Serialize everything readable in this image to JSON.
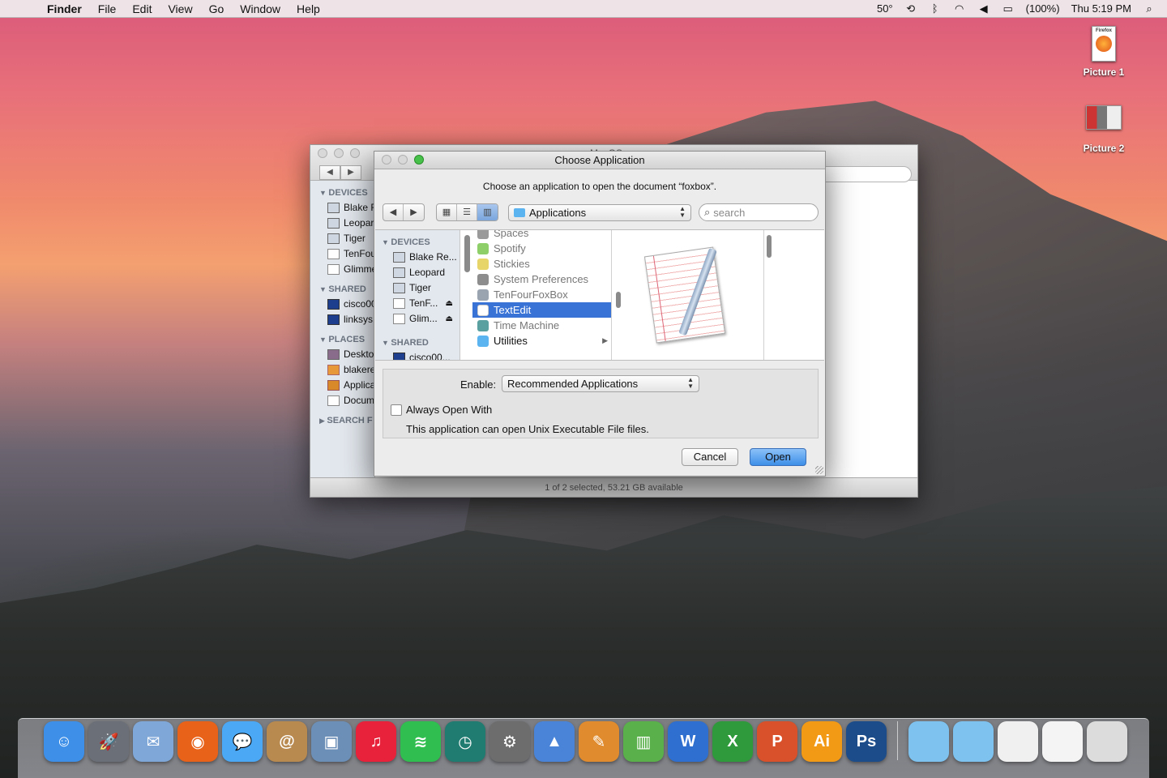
{
  "menubar": {
    "app_name": "Finder",
    "menus": [
      "File",
      "Edit",
      "View",
      "Go",
      "Window",
      "Help"
    ],
    "temperature": "50°",
    "battery": "(100%)",
    "clock": "Thu 5:19 PM"
  },
  "desktop_icons": [
    {
      "label": "Picture 1",
      "thumb_text": "Firefox"
    },
    {
      "label": "Picture 2"
    }
  ],
  "finder": {
    "title": "MacOS",
    "status": "1 of 2 selected, 53.21 GB available",
    "sidebar": {
      "devices_header": "DEVICES",
      "devices": [
        "Blake R",
        "Leopar",
        "Tiger",
        "TenFou",
        "Glimme"
      ],
      "shared_header": "SHARED",
      "shared": [
        "cisco00",
        "linksys"
      ],
      "places_header": "PLACES",
      "places": [
        "Deskto",
        "blakere",
        "Applica",
        "Docum"
      ],
      "search_header": "SEARCH F"
    }
  },
  "dialog": {
    "title": "Choose Application",
    "prompt": "Choose an application to open the document “foxbox”.",
    "location": "Applications",
    "search_placeholder": "search",
    "sidebar": {
      "devices_header": "DEVICES",
      "devices": [
        "Blake Re...",
        "Leopard",
        "Tiger",
        "TenF...",
        "Glim..."
      ],
      "shared_header": "SHARED",
      "shared": [
        "cisco00..."
      ]
    },
    "apps": [
      {
        "name": "Spaces",
        "color": "#9a9a9a"
      },
      {
        "name": "Spotify",
        "color": "#8fcf6a"
      },
      {
        "name": "Stickies",
        "color": "#e8d56a"
      },
      {
        "name": "System Preferences",
        "color": "#8d8d8d"
      },
      {
        "name": "TenFourFoxBox",
        "color": "#9aa4b0"
      },
      {
        "name": "TextEdit",
        "color": "#ffffff",
        "selected": true
      },
      {
        "name": "Time Machine",
        "color": "#5aa0a0"
      },
      {
        "name": "Utilities",
        "color": "#5bb3f0",
        "folder": true
      }
    ],
    "enable_label": "Enable:",
    "enable_value": "Recommended Applications",
    "always_open": "Always Open With",
    "note": "This application can open Unix Executable File files.",
    "cancel": "Cancel",
    "open": "Open"
  },
  "dock": [
    {
      "name": "finder",
      "color": "#3d8fe8",
      "glyph": "☺"
    },
    {
      "name": "launchpad",
      "color": "#6b6f78",
      "glyph": "🚀"
    },
    {
      "name": "mail",
      "color": "#7fa7d8",
      "glyph": "✉"
    },
    {
      "name": "firefox",
      "color": "#e8621a",
      "glyph": "◉"
    },
    {
      "name": "messages",
      "color": "#4aa8f5",
      "glyph": "💬"
    },
    {
      "name": "contacts",
      "color": "#b98a50",
      "glyph": "@"
    },
    {
      "name": "preview",
      "color": "#6c8fb7",
      "glyph": "▣"
    },
    {
      "name": "itunes",
      "color": "#e8223b",
      "glyph": "♫"
    },
    {
      "name": "spotify",
      "color": "#2fbe4f",
      "glyph": "≋"
    },
    {
      "name": "time-machine",
      "color": "#207b70",
      "glyph": "◷"
    },
    {
      "name": "system-preferences",
      "color": "#6d6d6d",
      "glyph": "⚙"
    },
    {
      "name": "keynote",
      "color": "#4a84d8",
      "glyph": "▲"
    },
    {
      "name": "pages",
      "color": "#e08b2d",
      "glyph": "✎"
    },
    {
      "name": "numbers",
      "color": "#5ab04a",
      "glyph": "▥"
    },
    {
      "name": "word",
      "color": "#2f6fd0",
      "glyph": "W"
    },
    {
      "name": "excel",
      "color": "#2f9a3c",
      "glyph": "X"
    },
    {
      "name": "powerpoint",
      "color": "#d9512a",
      "glyph": "P"
    },
    {
      "name": "illustrator",
      "color": "#f29a16",
      "glyph": "Ai"
    },
    {
      "name": "photoshop",
      "color": "#1c4c8a",
      "glyph": "Ps"
    }
  ],
  "dock_right": [
    {
      "name": "documents-folder",
      "color": "#7ec3f0"
    },
    {
      "name": "downloads-folder",
      "color": "#7ec3f0"
    },
    {
      "name": "stack-1",
      "color": "#f0f0f0"
    },
    {
      "name": "stack-2",
      "color": "#f4f4f4"
    },
    {
      "name": "trash",
      "color": "#dcdcdc"
    }
  ]
}
